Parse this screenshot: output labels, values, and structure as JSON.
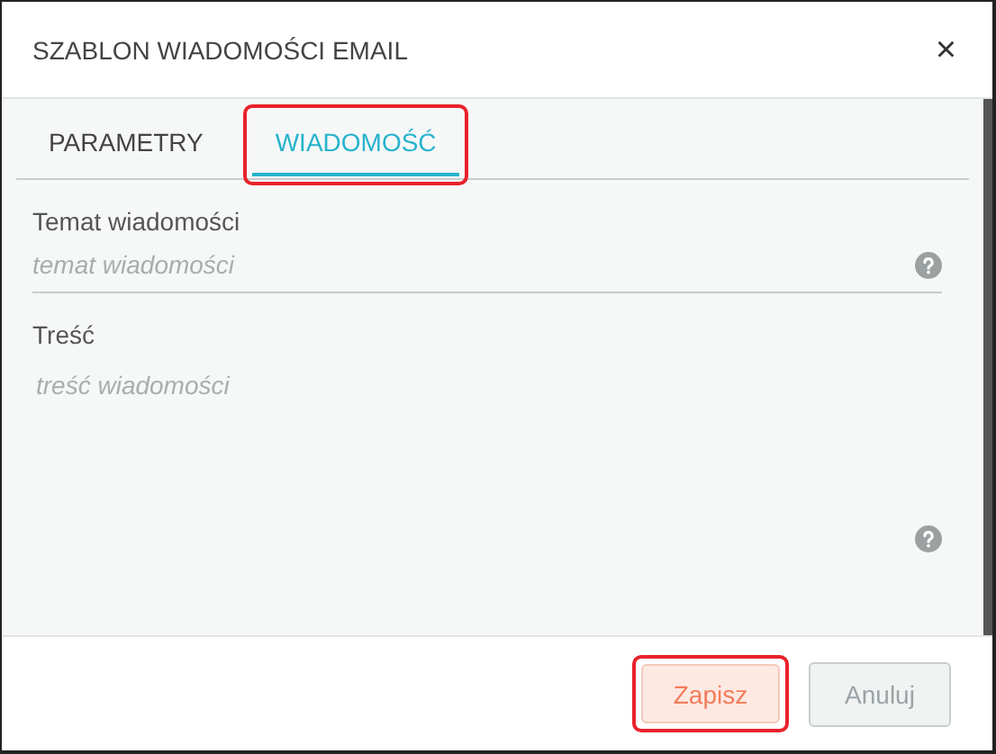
{
  "window": {
    "title": "SZABLON WIADOMOŚCI EMAIL",
    "close": "×"
  },
  "tabs": [
    {
      "label": "PARAMETRY",
      "selected": false,
      "highlighted": false
    },
    {
      "label": "WIADOMOŚĆ",
      "selected": true,
      "highlighted": true
    }
  ],
  "fields": [
    {
      "label": "Temat wiadomości",
      "placeholder": "temat wiadomości",
      "kind": "input"
    },
    {
      "label": "Treść",
      "placeholder": "treść wiadomości",
      "kind": "textarea"
    }
  ],
  "buttons": [
    {
      "label": "Zapisz",
      "kind": "primary",
      "highlighted": true
    },
    {
      "label": "Anuluj",
      "kind": "secondary",
      "highlighted": false
    }
  ]
}
